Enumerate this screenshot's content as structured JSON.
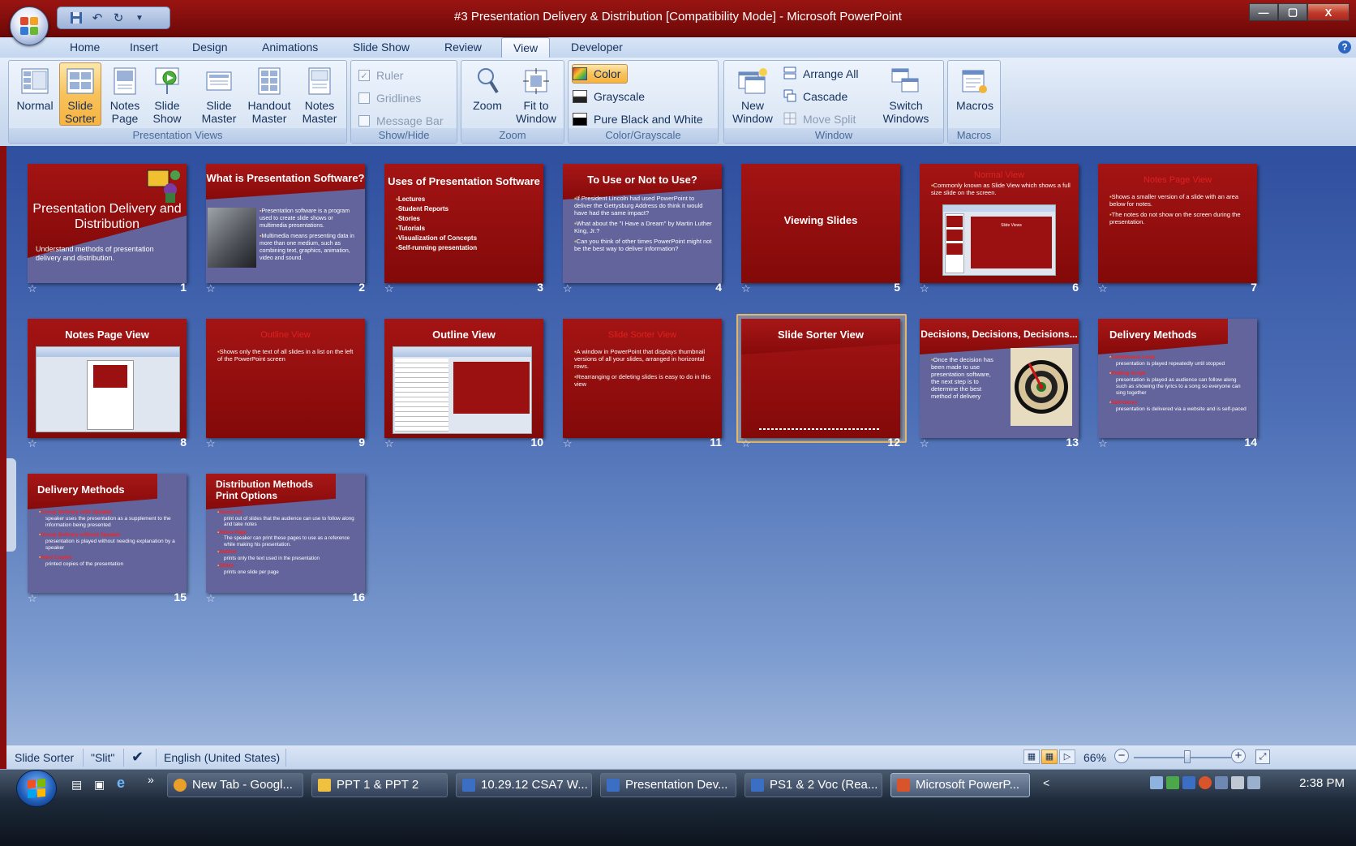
{
  "window": {
    "title": "#3 Presentation Delivery & Distribution [Compatibility Mode] - Microsoft PowerPoint",
    "minimize": "—",
    "maximize": "▢",
    "close": "X"
  },
  "tabs": [
    {
      "label": "Home"
    },
    {
      "label": "Insert"
    },
    {
      "label": "Design"
    },
    {
      "label": "Animations"
    },
    {
      "label": "Slide Show"
    },
    {
      "label": "Review"
    },
    {
      "label": "View",
      "active": true
    },
    {
      "label": "Developer"
    }
  ],
  "ribbon": {
    "presentation_views": {
      "label": "Presentation Views",
      "normal": "Normal",
      "slide_sorter_1": "Slide",
      "slide_sorter_2": "Sorter",
      "notes_page_1": "Notes",
      "notes_page_2": "Page",
      "slide_show_1": "Slide",
      "slide_show_2": "Show",
      "slide_master_1": "Slide",
      "slide_master_2": "Master",
      "handout_master_1": "Handout",
      "handout_master_2": "Master",
      "notes_master_1": "Notes",
      "notes_master_2": "Master"
    },
    "show_hide": {
      "label": "Show/Hide",
      "ruler": "Ruler",
      "gridlines": "Gridlines",
      "message_bar": "Message Bar"
    },
    "zoom": {
      "label": "Zoom",
      "zoom": "Zoom",
      "fit_1": "Fit to",
      "fit_2": "Window"
    },
    "color": {
      "label": "Color/Grayscale",
      "color": "Color",
      "grayscale": "Grayscale",
      "pure": "Pure Black and White"
    },
    "window": {
      "label": "Window",
      "new_1": "New",
      "new_2": "Window",
      "arrange": "Arrange All",
      "cascade": "Cascade",
      "move_split": "Move Split",
      "switch_1": "Switch",
      "switch_2": "Windows"
    },
    "macros": {
      "label": "Macros",
      "macros": "Macros"
    }
  },
  "slides": [
    {
      "num": "1",
      "title": "Presentation Delivery and Distribution",
      "subtitle": "Understand methods of presentation delivery and distribution."
    },
    {
      "num": "2",
      "title": "What is Presentation Software?",
      "b1": "Presentation software is a program used to create slide shows or multimedia presentations.",
      "b2": "Multimedia means presenting data in more than one medium, such as combining text, graphics, animation, video and sound."
    },
    {
      "num": "3",
      "title": "Uses of Presentation Software",
      "items": [
        "Lectures",
        "Student Reports",
        "Stories",
        "Tutorials",
        "Visualization of Concepts",
        "Self-running presentation"
      ]
    },
    {
      "num": "4",
      "title": "To Use or Not to Use?",
      "b1": "If President Lincoln had used PowerPoint to deliver the Gettysburg Address do think it would have had the same impact?",
      "b2": "What about the \"I Have a Dream\" by Martin Luther King, Jr.?",
      "b3": "Can you think of other times PowerPoint might not be the best way to deliver information?"
    },
    {
      "num": "5",
      "title": "Viewing Slides"
    },
    {
      "num": "6",
      "title": "Normal View",
      "b1": "Commonly known as Slide View which shows a full size slide on the screen.",
      "shot_title": "Slide Views"
    },
    {
      "num": "7",
      "title": "Notes Page View",
      "b1": "Shows a smaller version of a slide with an area below for notes.",
      "b2": "The notes do not show on the screen during the presentation."
    },
    {
      "num": "8",
      "title": "Notes Page View"
    },
    {
      "num": "9",
      "title": "Outline View",
      "b1": "Shows only the text of all slides in a list on the left of the PowerPoint screen"
    },
    {
      "num": "10",
      "title": "Outline View"
    },
    {
      "num": "11",
      "title": "Slide Sorter View",
      "b1": "A window in PowerPoint that displays thumbnail versions of all your slides, arranged in horizontal rows.",
      "b2": "Rearranging or deleting slides is easy to do in this view"
    },
    {
      "num": "12",
      "title": "Slide Sorter View"
    },
    {
      "num": "13",
      "title": "Decisions, Decisions, Decisions...",
      "b1": "Once the decision has been made to use presentation software, the next step is to determine the best method of delivery"
    },
    {
      "num": "14",
      "title": "Delivery Methods",
      "h1": "Continuous Loop",
      "s1": "presentation is played repeatedly until stopped",
      "h2": "Rolling Script",
      "s2": "presentation is played as audience can follow along such as showing the lyrics to a song so everyone can sing together",
      "h3": "Self-Serve",
      "s3": "presentation is delivered via a website and is self-paced"
    },
    {
      "num": "15",
      "title": "Delivery Methods",
      "h1": "Group Delivery with Speaker",
      "s1": "speaker uses the presentation as a supplement to the information being presented",
      "h2": "Group Delivery without Speaker",
      "s2": "presentation is played without needing explanation by a speaker",
      "h3": "Hard Copies",
      "s3": "printed copies of the presentation"
    },
    {
      "num": "16",
      "title": "Distribution Methods Print Options",
      "h1": "Handouts",
      "s1": "print out of slides that the audience can use to follow along and take notes",
      "h2": "Notes Page",
      "s2": "The speaker can print these pages to use as a reference while making his presentation.",
      "h3": "Outline",
      "s3": "prints only the text used in the presentation",
      "h4": "Slides",
      "s4": "prints one slide per page"
    }
  ],
  "status": {
    "view": "Slide Sorter",
    "theme": "\"Slit\"",
    "language": "English (United States)",
    "zoom": "66%"
  },
  "taskbar": {
    "buttons": [
      {
        "label": "New Tab - Googl...",
        "color": "#e8a02a"
      },
      {
        "label": "PPT 1 & PPT 2",
        "color": "#f0c040"
      },
      {
        "label": "10.29.12 CSA7 W...",
        "color": "#3b6fc4"
      },
      {
        "label": "Presentation Dev...",
        "color": "#3b6fc4"
      },
      {
        "label": "PS1 & 2 Voc (Rea...",
        "color": "#3b6fc4"
      },
      {
        "label": "Microsoft PowerP...",
        "color": "#d9542b",
        "active": true
      }
    ],
    "chevron": "»",
    "tray_chevron": "<",
    "clock": "2:38 PM"
  }
}
